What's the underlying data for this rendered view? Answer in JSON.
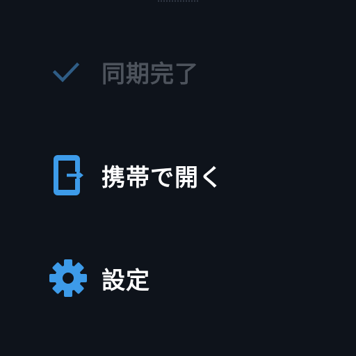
{
  "menu": {
    "items": [
      {
        "label": "同期完了",
        "icon": "checkmark-icon",
        "state": "disabled"
      },
      {
        "label": "携帯で開く",
        "icon": "open-on-phone-icon",
        "state": "enabled"
      },
      {
        "label": "設定",
        "icon": "gear-icon",
        "state": "enabled"
      }
    ]
  },
  "colors": {
    "background": "#0e131b",
    "accent": "#3d9be9",
    "disabled_icon": "#2f5d86",
    "disabled_text": "#4d535c",
    "text": "#ffffff"
  }
}
